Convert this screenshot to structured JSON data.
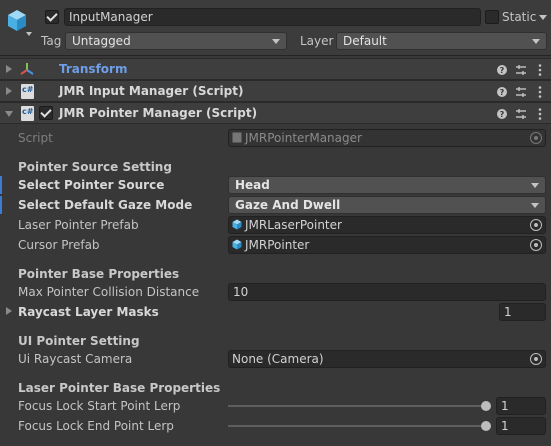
{
  "header": {
    "object_name": "InputManager",
    "active_checked": true,
    "static_label": "Static",
    "tag_label": "Tag",
    "tag_value": "Untagged",
    "layer_label": "Layer",
    "layer_value": "Default"
  },
  "components": [
    {
      "name": "Transform",
      "expanded": false,
      "has_checkbox": false,
      "title_color": "#6e9fe8"
    },
    {
      "name": "JMR Input Manager (Script)",
      "expanded": false,
      "has_checkbox": false
    },
    {
      "name": "JMR Pointer Manager (Script)",
      "expanded": true,
      "has_checkbox": true,
      "checked": true
    }
  ],
  "pointer_manager": {
    "script_label": "Script",
    "script_value": "JMRPointerManager",
    "section_source": "Pointer Source Setting",
    "select_pointer_source_label": "Select Pointer Source",
    "select_pointer_source_value": "Head",
    "select_gaze_mode_label": "Select Default Gaze Mode",
    "select_gaze_mode_value": "Gaze And Dwell",
    "laser_pointer_prefab_label": "Laser Pointer Prefab",
    "laser_pointer_prefab_value": "JMRLaserPointer",
    "cursor_prefab_label": "Cursor Prefab",
    "cursor_prefab_value": "JMRPointer",
    "section_base": "Pointer Base Properties",
    "max_collision_label": "Max Pointer Collision Distance",
    "max_collision_value": "10",
    "raycast_masks_label": "Raycast Layer Masks",
    "raycast_masks_value": "1",
    "section_ui": "UI Pointer Setting",
    "ui_camera_label": "Ui Raycast Camera",
    "ui_camera_value": "None (Camera)",
    "section_laser": "Laser Pointer Base Properties",
    "focus_start_label": "Focus Lock Start Point Lerp",
    "focus_start_value": "1",
    "focus_start_fraction": 1,
    "focus_end_label": "Focus Lock End Point Lerp",
    "focus_end_value": "1",
    "focus_end_fraction": 1
  },
  "colors": {
    "accent_blue": "#3e7bd6",
    "background": "#383838",
    "field_background": "#2a2a2a"
  }
}
